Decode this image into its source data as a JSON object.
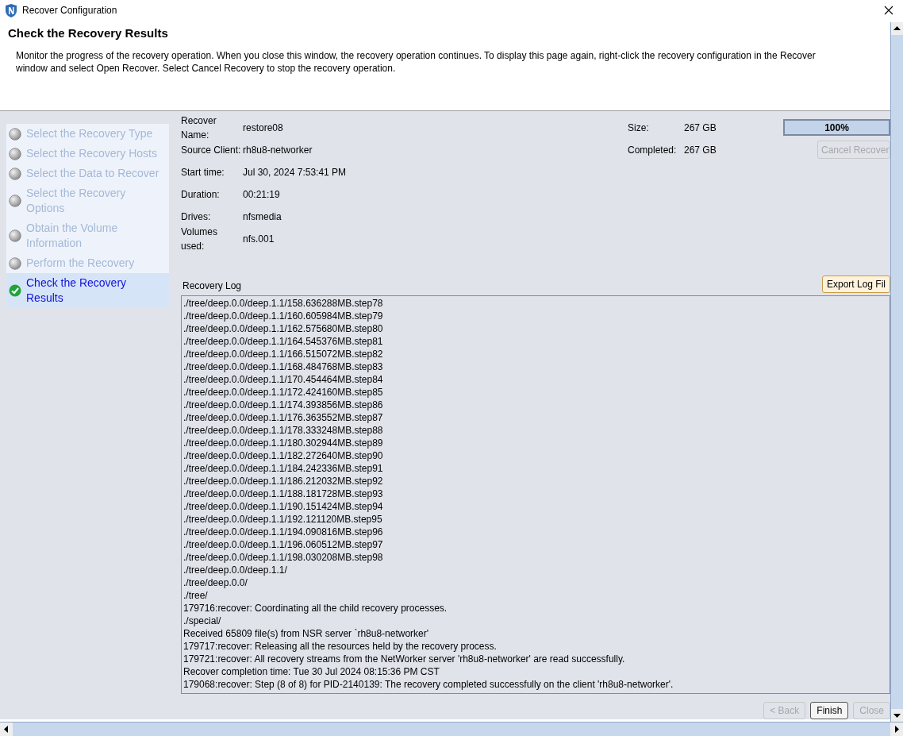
{
  "window": {
    "title": "Recover Configuration"
  },
  "header": {
    "title": "Check the Recovery Results",
    "description": "Monitor the progress of the recovery operation. When you close this window, the recovery operation continues. To display this page again, right-click the recovery configuration in the Recover window and select Open Recover. Select Cancel Recovery to stop the recovery operation."
  },
  "steps": [
    {
      "label": "Select the Recovery Type",
      "selected": false
    },
    {
      "label": "Select the Recovery Hosts",
      "selected": false
    },
    {
      "label": "Select the Data to Recover",
      "selected": false
    },
    {
      "label": "Select the Recovery Options",
      "selected": false
    },
    {
      "label": "Obtain the Volume Information",
      "selected": false
    },
    {
      "label": "Perform the Recovery",
      "selected": false
    },
    {
      "label": "Check the Recovery Results",
      "selected": true
    }
  ],
  "details": [
    {
      "label": "Recover Name:",
      "value": "restore08"
    },
    {
      "label": "Source Client:",
      "value": "rh8u8-networker"
    },
    {
      "label": "Start time:",
      "value": "Jul 30, 2024 7:53:41 PM"
    },
    {
      "label": "Duration:",
      "value": "00:21:19"
    },
    {
      "label": "Drives:",
      "value": "nfsmedia"
    },
    {
      "label": "Volumes used:",
      "value": "nfs.001"
    }
  ],
  "size": [
    {
      "label": "Size:",
      "value": "267 GB"
    },
    {
      "label": "Completed:",
      "value": "267 GB"
    }
  ],
  "progress": {
    "level": 1,
    "reading": "100%"
  },
  "cancel_button": {
    "label": "Cancel Recover",
    "disabled": true
  },
  "log": {
    "title": "Recovery Log",
    "export_button": "Export Log Fil",
    "lines": [
      "./tree/deep.0.0/deep.1.1/158.636288MB.step78",
      "./tree/deep.0.0/deep.1.1/160.605984MB.step79",
      "./tree/deep.0.0/deep.1.1/162.575680MB.step80",
      "./tree/deep.0.0/deep.1.1/164.545376MB.step81",
      "./tree/deep.0.0/deep.1.1/166.515072MB.step82",
      "./tree/deep.0.0/deep.1.1/168.484768MB.step83",
      "./tree/deep.0.0/deep.1.1/170.454464MB.step84",
      "./tree/deep.0.0/deep.1.1/172.424160MB.step85",
      "./tree/deep.0.0/deep.1.1/174.393856MB.step86",
      "./tree/deep.0.0/deep.1.1/176.363552MB.step87",
      "./tree/deep.0.0/deep.1.1/178.333248MB.step88",
      "./tree/deep.0.0/deep.1.1/180.302944MB.step89",
      "./tree/deep.0.0/deep.1.1/182.272640MB.step90",
      "./tree/deep.0.0/deep.1.1/184.242336MB.step91",
      "./tree/deep.0.0/deep.1.1/186.212032MB.step92",
      "./tree/deep.0.0/deep.1.1/188.181728MB.step93",
      "./tree/deep.0.0/deep.1.1/190.151424MB.step94",
      "./tree/deep.0.0/deep.1.1/192.121120MB.step95",
      "./tree/deep.0.0/deep.1.1/194.090816MB.step96",
      "./tree/deep.0.0/deep.1.1/196.060512MB.step97",
      "./tree/deep.0.0/deep.1.1/198.030208MB.step98",
      "./tree/deep.0.0/deep.1.1/",
      "./tree/deep.0.0/",
      "./tree/",
      "179716:recover: Coordinating all the child recovery processes.",
      "./special/",
      "Received 65809 file(s) from NSR server `rh8u8-networker'",
      "179717:recover: Releasing all the resources held by the recovery process.",
      "179721:recover: All recovery streams from the NetWorker server 'rh8u8-networker' are read successfully.",
      "Recover completion time: Tue 30 Jul 2024 08:15:36 PM CST",
      "179068:recover: Step (8 of 8) for PID-2140139: The recovery completed successfully on the client 'rh8u8-networker'."
    ]
  },
  "footer_buttons": [
    {
      "label": "< Back",
      "disabled": true
    },
    {
      "label": "Finish",
      "disabled": false
    },
    {
      "label": "Close",
      "disabled": true
    }
  ]
}
